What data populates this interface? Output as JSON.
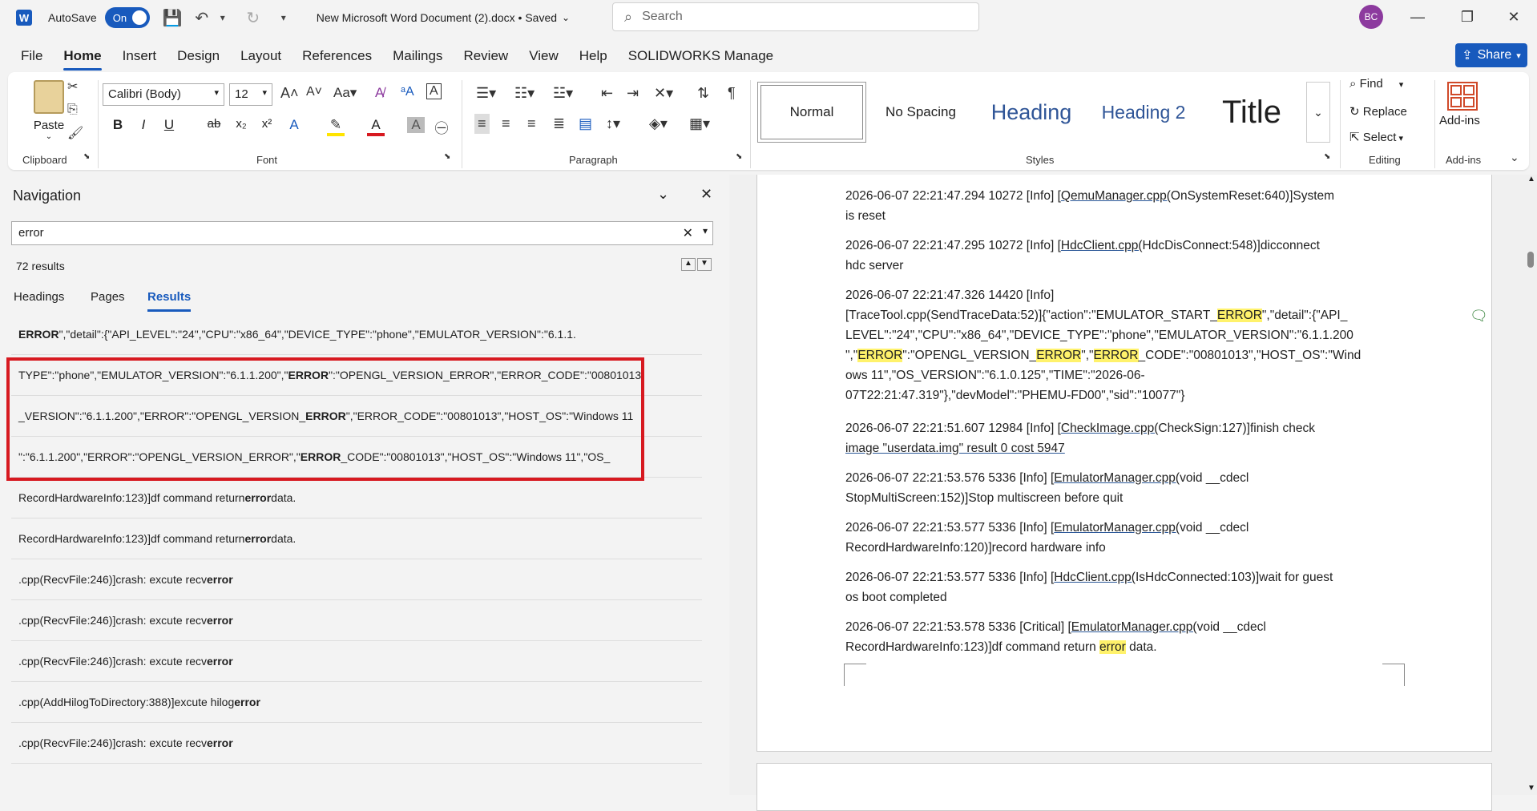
{
  "titlebar": {
    "autosave_label": "AutoSave",
    "autosave_state": "On",
    "document_title": "New Microsoft Word Document (2).docx • Saved",
    "search_placeholder": "Search",
    "user_initials": "BC"
  },
  "menu": {
    "tabs": [
      "File",
      "Home",
      "Insert",
      "Design",
      "Layout",
      "References",
      "Mailings",
      "Review",
      "View",
      "Help",
      "SOLIDWORKS Manage"
    ],
    "share_label": "Share"
  },
  "ribbon": {
    "clipboard": {
      "paste_label": "Paste",
      "group_label": "Clipboard"
    },
    "font": {
      "font_name": "Calibri (Body)",
      "font_size": "12",
      "group_label": "Font"
    },
    "paragraph": {
      "group_label": "Paragraph"
    },
    "styles": {
      "items": [
        "Normal",
        "No Spacing",
        "Heading",
        "Heading 2",
        "Title"
      ],
      "group_label": "Styles"
    },
    "editing": {
      "find_label": "Find",
      "replace_label": "Replace",
      "select_label": "Select",
      "group_label": "Editing"
    },
    "addins": {
      "label": "Add-ins",
      "group_label": "Add-ins"
    }
  },
  "navigation": {
    "title": "Navigation",
    "search_value": "error",
    "results_count": "72 results",
    "tabs": [
      "Headings",
      "Pages",
      "Results"
    ],
    "results": [
      {
        "pre": "",
        "bold": "ERROR",
        "post": "\",\"detail\":{\"API_LEVEL\":\"24\",\"CPU\":\"x86_64\",\"DEVICE_TYPE\":\"phone\",\"EMULATOR_VERSION\":\"6.1.1."
      },
      {
        "pre": "TYPE\":\"phone\",\"EMULATOR_VERSION\":\"6.1.1.200\",\"",
        "bold": "ERROR",
        "post": "\":\"OPENGL_VERSION_ERROR\",\"ERROR_CODE\":\"00801013"
      },
      {
        "pre": "_VERSION\":\"6.1.1.200\",\"ERROR\":\"OPENGL_VERSION_",
        "bold": "ERROR",
        "post": "\",\"ERROR_CODE\":\"00801013\",\"HOST_OS\":\"Windows 11"
      },
      {
        "pre": "\":\"6.1.1.200\",\"ERROR\":\"OPENGL_VERSION_ERROR\",\"",
        "bold": "ERROR",
        "post": "_CODE\":\"00801013\",\"HOST_OS\":\"Windows 11\",\"OS_"
      },
      {
        "pre": "RecordHardwareInfo:123)]df command return ",
        "bold": "error",
        "post": " data."
      },
      {
        "pre": "RecordHardwareInfo:123)]df command return ",
        "bold": "error",
        "post": " data."
      },
      {
        "pre": ".cpp(RecvFile:246)]crash: excute recv ",
        "bold": "error",
        "post": ""
      },
      {
        "pre": ".cpp(RecvFile:246)]crash: excute recv ",
        "bold": "error",
        "post": ""
      },
      {
        "pre": ".cpp(RecvFile:246)]crash: excute recv ",
        "bold": "error",
        "post": ""
      },
      {
        "pre": ".cpp(AddHilogToDirectory:388)]excute hilog ",
        "bold": "error",
        "post": ""
      },
      {
        "pre": ".cpp(RecvFile:246)]crash: excute recv ",
        "bold": "error",
        "post": ""
      }
    ]
  },
  "document": {
    "p1_a": "2026-06-07 22:21:47.294 10272 [Info] [",
    "p1_link": "QemuManager.cpp(",
    "p1_b": "OnSystemReset:640)]System",
    "p1_c": "is reset",
    "p2_a": "2026-06-07 22:21:47.295 10272 [Info] [",
    "p2_link": "HdcClient.cpp(",
    "p2_b": "HdcDisConnect:548)]dicconnect",
    "p2_c": "hdc server",
    "p3_l1": "2026-06-07 22:21:47.326 14420 [Info]",
    "p3_l2a": "[TraceTool.cpp(SendTraceData:52)]{\"action\":\"EMULATOR_START_",
    "p3_hl1": "ERROR",
    "p3_l2b": "\",\"detail\":{\"API_",
    "p3_l3": "LEVEL\":\"24\",\"CPU\":\"x86_64\",\"DEVICE_TYPE\":\"phone\",\"EMULATOR_VERSION\":\"6.1.1.200",
    "p3_l4a": "\",\"",
    "p3_hl2": "ERROR",
    "p3_l4b": "\":\"OPENGL_VERSION_",
    "p3_hl3": "ERROR",
    "p3_l4c": "\",\"",
    "p3_hl4": "ERROR",
    "p3_l4d": "_CODE\":\"00801013\",\"HOST_OS\":\"Wind",
    "p3_l5": "ows 11\",\"OS_VERSION\":\"6.1.0.125\",\"TIME\":\"2026-06-",
    "p3_l6": "07T22:21:47.319\"},\"devModel\":\"PHEMU-FD00\",\"sid\":\"10077\"}",
    "p4_a": "2026-06-07 22:21:51.607 12984 [Info] [",
    "p4_link": "CheckImage.cpp(",
    "p4_b": "CheckSign:127)]finish check",
    "p4_c": "image \"userdata.img\" result 0 cost 5947",
    "p5_a": "2026-06-07 22:21:53.576 5336 [Info] [",
    "p5_link": "EmulatorManager.cpp(",
    "p5_b": "void __cdecl",
    "p5_c": "StopMultiScreen:152)]Stop multiscreen before quit",
    "p6_a": "2026-06-07 22:21:53.577 5336 [Info] [",
    "p6_link": "EmulatorManager.cpp(",
    "p6_b": "void __cdecl",
    "p6_c": "RecordHardwareInfo:120)]record hardware info",
    "p7_a": "2026-06-07 22:21:53.577 5336 [Info] [",
    "p7_link": "HdcClient.cpp(",
    "p7_b": "IsHdcConnected:103)]wait for guest",
    "p7_c": "os boot completed",
    "p8_a": "2026-06-07 22:21:53.578 5336 [Critical] [",
    "p8_link": "EmulatorManager.cpp(",
    "p8_b": "void __cdecl",
    "p8_c1": "RecordHardwareInfo:123)]df command return ",
    "p8_hl": "error",
    "p8_c2": " data."
  },
  "colors": {
    "accent": "#185abd",
    "highlight": "#fff26b",
    "redbox": "#d71920"
  }
}
